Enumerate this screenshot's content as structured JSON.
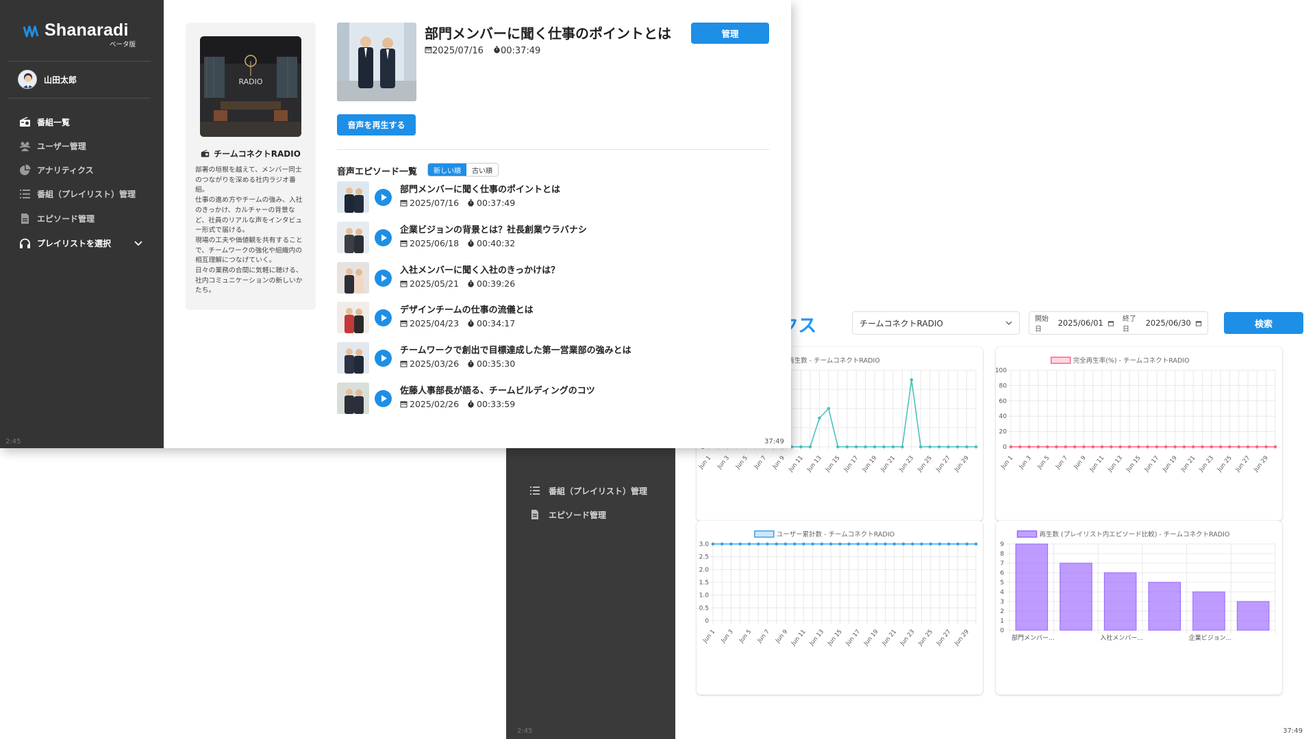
{
  "back": {
    "title_fragment": "クス",
    "select_value": "チームコネクトRADIO",
    "date": {
      "start_label": "開始日",
      "start": "2025/06/01",
      "end_label": "終了日",
      "end": "2025/06/30"
    },
    "search_label": "検索",
    "sidebar": {
      "items": [
        {
          "label": "番組（プレイリスト）管理",
          "icon": "list-icon"
        },
        {
          "label": "エピソード管理",
          "icon": "file-icon"
        }
      ]
    },
    "time_left": "2:45",
    "time_right": "37:49"
  },
  "front": {
    "logo": "Shanaradi",
    "logo_sub": "ベータ版",
    "user": "山田太郎",
    "nav": [
      {
        "label": "番組一覧",
        "icon": "radio-icon"
      },
      {
        "label": "ユーザー管理",
        "icon": "users-icon"
      },
      {
        "label": "アナリティクス",
        "icon": "pie-chart-icon"
      },
      {
        "label": "番組（プレイリスト）管理",
        "icon": "list-icon"
      },
      {
        "label": "エピソード管理",
        "icon": "file-icon"
      },
      {
        "label": "プレイリストを選択",
        "icon": "headphones-icon"
      }
    ],
    "program": {
      "name": "チームコネクトRADIO",
      "cover_text": "RADIO",
      "description_lines": [
        "部署の垣根を越えて、メンバー同士",
        "のつながりを深める社内ラジオ番",
        "組。",
        "仕事の進め方やチームの強み、入社",
        "のきっかけ、カルチャーの背景な",
        "ど、社員のリアルな声をインタビュ",
        "ー形式で届ける。",
        "現場の工夫や価値観を共有すること",
        "で、チームワークの強化や組織内の",
        "相互理解につなげていく。",
        "日々の業務の合間に気軽に聴ける、",
        "社内コミュニケーションの新しいか",
        "たち。"
      ]
    },
    "episode": {
      "title": "部門メンバーに聞く仕事のポイントとは",
      "date": "2025/07/16",
      "duration": "00:37:49"
    },
    "manage_label": "管理",
    "play_label": "音声を再生する",
    "list_title": "音声エピソード一覧",
    "sort_new": "新しい順",
    "sort_old": "古い順",
    "episodes": [
      {
        "title": "部門メンバーに聞く仕事のポイントとは",
        "date": "2025/07/16",
        "duration": "00:37:49"
      },
      {
        "title": "企業ビジョンの背景とは？社長創業ウラバナシ",
        "date": "2025/06/18",
        "duration": "00:40:32"
      },
      {
        "title": "入社メンバーに聞く入社のきっかけは？",
        "date": "2025/05/21",
        "duration": "00:39:26"
      },
      {
        "title": "デザインチームの仕事の流儀とは",
        "date": "2025/04/23",
        "duration": "00:34:17"
      },
      {
        "title": "チームワークで創出で目標達成した第一営業部の強みとは",
        "date": "2025/03/26",
        "duration": "00:35:30"
      },
      {
        "title": "佐藤人事部長が語る、チームビルディングのコツ",
        "date": "2025/02/26",
        "duration": "00:33:59"
      }
    ],
    "time_left": "2:45",
    "time_right": "37:49"
  },
  "colors": {
    "accent": "#1e8fe6",
    "sidebar": "#343434",
    "teal": "#4bc0c0",
    "pink": "#ff6384",
    "blue": "#36a2eb",
    "purple": "#9966ff"
  },
  "chart_data": [
    {
      "type": "line",
      "legend": "再生数 - チームコネクトRADIO",
      "x": [
        "Jun 1",
        "Jun 2",
        "Jun 3",
        "Jun 4",
        "Jun 5",
        "Jun 6",
        "Jun 7",
        "Jun 8",
        "Jun 9",
        "Jun 10",
        "Jun 11",
        "Jun 12",
        "Jun 13",
        "Jun 14",
        "Jun 15",
        "Jun 16",
        "Jun 17",
        "Jun 18",
        "Jun 19",
        "Jun 20",
        "Jun 21",
        "Jun 22",
        "Jun 23",
        "Jun 24",
        "Jun 25",
        "Jun 26",
        "Jun 27",
        "Jun 28",
        "Jun 29",
        "Jun 30"
      ],
      "x_tick_labels": [
        "Jun 1",
        "Jun 3",
        "Jun 5",
        "Jun 7",
        "Jun 9",
        "Jun 11",
        "Jun 13",
        "Jun 15",
        "Jun 17",
        "Jun 19",
        "Jun 21",
        "Jun 23",
        "Jun 25",
        "Jun 27",
        "Jun 29"
      ],
      "values": [
        0,
        0,
        0,
        1,
        6,
        1,
        0,
        0,
        0,
        0,
        0,
        0,
        3,
        4,
        0,
        0,
        0,
        0,
        0,
        0,
        0,
        0,
        7,
        0,
        0,
        0,
        0,
        0,
        0,
        0
      ],
      "ylim": [
        0,
        8
      ],
      "color": "#4bc0c0"
    },
    {
      "type": "line",
      "legend": "完全再生率(%) - チームコネクトRADIO",
      "x_tick_labels": [
        "Jun 1",
        "Jun 3",
        "Jun 5",
        "Jun 7",
        "Jun 9",
        "Jun 11",
        "Jun 13",
        "Jun 15",
        "Jun 17",
        "Jun 19",
        "Jun 21",
        "Jun 23",
        "Jun 25",
        "Jun 27",
        "Jun 29"
      ],
      "values": [
        0,
        0,
        0,
        0,
        0,
        0,
        0,
        0,
        0,
        0,
        0,
        0,
        0,
        0,
        0,
        0,
        0,
        0,
        0,
        0,
        0,
        0,
        0,
        0,
        0,
        0,
        0,
        0,
        0,
        0
      ],
      "ylim": [
        0,
        100
      ],
      "y_ticks": [
        0,
        20,
        40,
        60,
        80,
        100
      ],
      "color": "#ff6384"
    },
    {
      "type": "line",
      "legend": "ユーザー累計数 - チームコネクトRADIO",
      "x_tick_labels": [
        "Jun 1",
        "Jun 3",
        "Jun 5",
        "Jun 7",
        "Jun 9",
        "Jun 11",
        "Jun 13",
        "Jun 15",
        "Jun 17",
        "Jun 19",
        "Jun 21",
        "Jun 23",
        "Jun 25",
        "Jun 27",
        "Jun 29"
      ],
      "values": [
        3,
        3,
        3,
        3,
        3,
        3,
        3,
        3,
        3,
        3,
        3,
        3,
        3,
        3,
        3,
        3,
        3,
        3,
        3,
        3,
        3,
        3,
        3,
        3,
        3,
        3,
        3,
        3,
        3,
        3
      ],
      "ylim": [
        0,
        3
      ],
      "y_ticks": [
        "0",
        "0.5",
        "1.0",
        "1.5",
        "2.0",
        "2.5",
        "3.0"
      ],
      "color": "#36a2eb"
    },
    {
      "type": "bar",
      "legend": "再生数 (プレイリスト内エピソード比較) - チームコネクトRADIO",
      "categories": [
        "部門メンバー...",
        "",
        "入社メンバー...",
        "",
        "企業ビジョン...",
        ""
      ],
      "values": [
        9,
        7,
        6,
        5,
        4,
        3
      ],
      "ylim": [
        0,
        9
      ],
      "y_ticks": [
        0,
        1,
        2,
        3,
        4,
        5,
        6,
        7,
        8,
        9
      ],
      "color": "#9966ff"
    }
  ]
}
